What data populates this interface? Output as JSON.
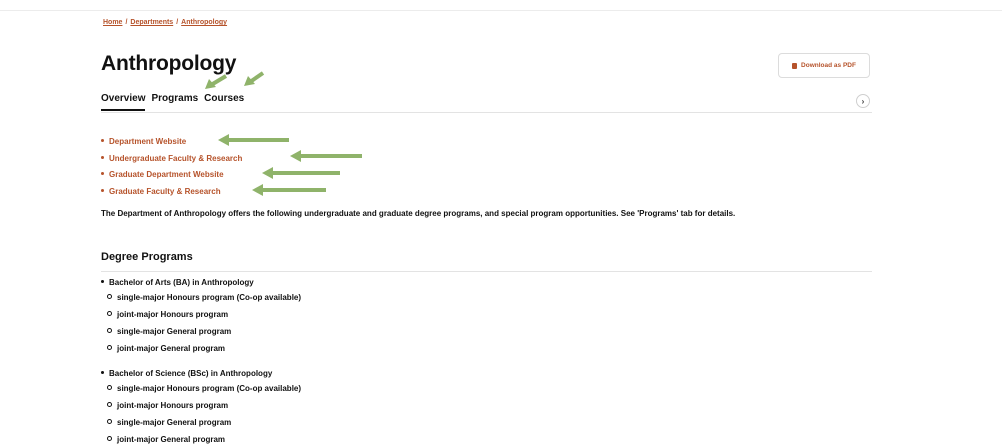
{
  "breadcrumb": {
    "items": [
      "Home",
      "Departments",
      "Anthropology"
    ],
    "separator": "/"
  },
  "page": {
    "title": "Anthropology",
    "download_label": "Download as PDF"
  },
  "tabs": [
    {
      "label": "Overview",
      "active": true
    },
    {
      "label": "Programs",
      "active": false
    },
    {
      "label": "Courses",
      "active": false
    }
  ],
  "links": [
    "Department Website",
    "Undergraduate Faculty & Research",
    "Graduate Department Website",
    "Graduate Faculty & Research"
  ],
  "intro": "The Department of Anthropology offers the following undergraduate and graduate degree programs, and special program opportunities. See 'Programs' tab for details.",
  "degree_programs": {
    "heading": "Degree Programs",
    "degrees": [
      {
        "name": "Bachelor of Arts (BA) in Anthropology",
        "options": [
          "single-major Honours program (Co-op available)",
          "joint-major Honours program",
          "single-major General program",
          "joint-major General program"
        ]
      },
      {
        "name": "Bachelor of Science (BSc) in Anthropology",
        "options": [
          "single-major Honours program (Co-op available)",
          "joint-major Honours program",
          "single-major General program",
          "joint-major General program"
        ]
      }
    ]
  },
  "colors": {
    "link": "#b6532b",
    "annotation_arrow": "#8fb36a",
    "text": "#111111"
  },
  "icons": {
    "download": "pdf-file-icon",
    "scroll_tabs": "chevron-right-icon"
  }
}
